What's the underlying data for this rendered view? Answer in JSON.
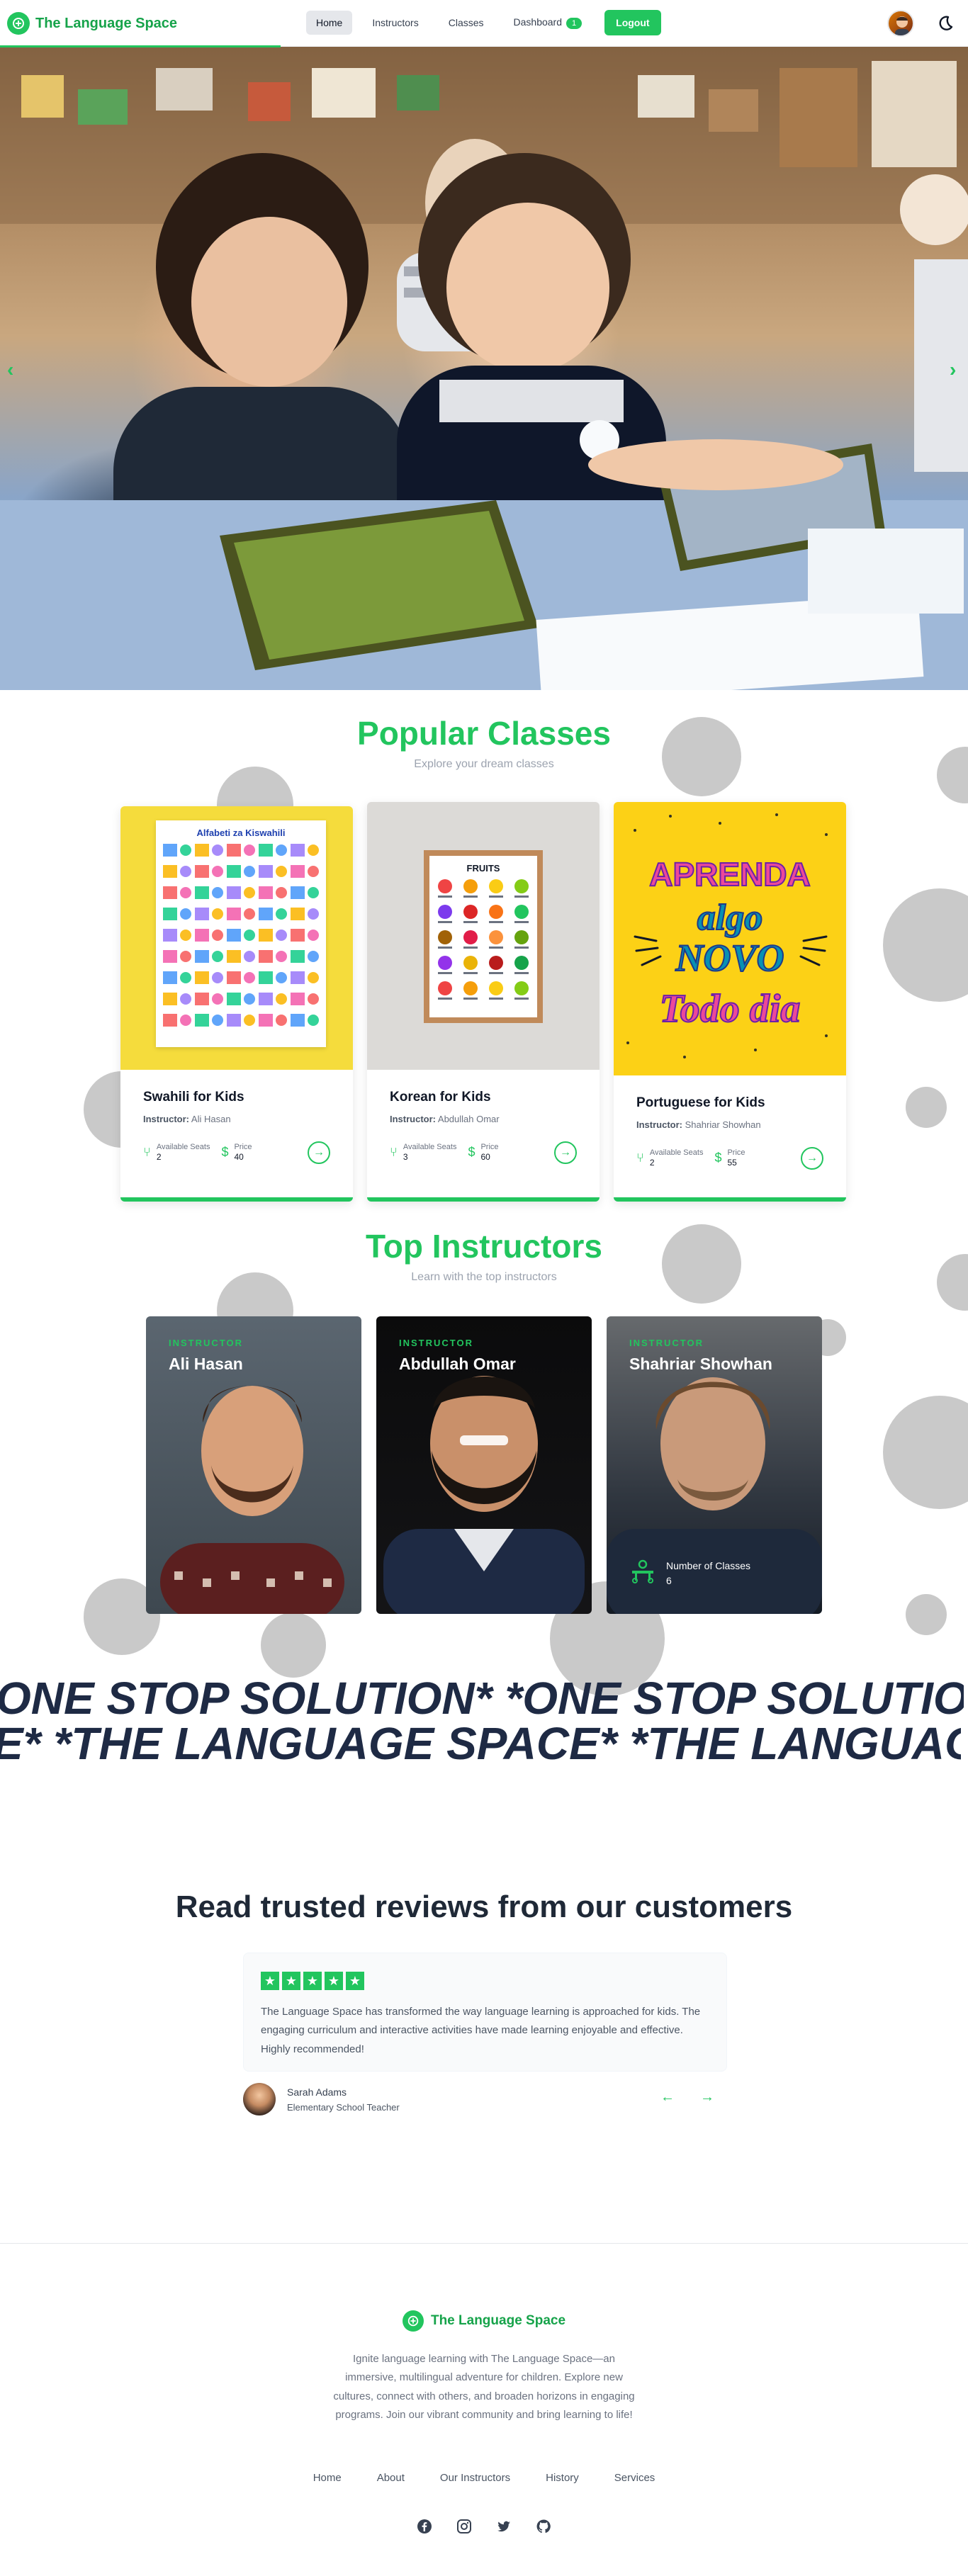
{
  "brand": {
    "name": "The Language Space"
  },
  "nav": {
    "links": [
      "Home",
      "Instructors",
      "Classes",
      "Dashboard"
    ],
    "dashboard_badge": "1",
    "logout": "Logout"
  },
  "colors": {
    "accent": "#22c55e",
    "dark_text": "#1e2a44",
    "dot_gray": "#c9c9c9"
  },
  "icons": [
    "theme-moon-icon",
    "arrow-right-icon",
    "seat-icon",
    "dollar-icon",
    "chair-group-icon",
    "facebook-icon",
    "instagram-icon",
    "twitter-icon",
    "github-icon"
  ],
  "popular": {
    "title": "Popular Classes",
    "subtitle": "Explore your dream classes",
    "instructor_prefix": "Instructor:",
    "seats_label": "Available Seats",
    "price_label": "Price",
    "classes": [
      {
        "title": "Swahili for Kids",
        "instructor": "Ali Hasan",
        "seats": "2",
        "price": "40",
        "poster_title": "Alfabeti za Kiswahili"
      },
      {
        "title": "Korean for Kids",
        "instructor": "Abdullah Omar",
        "seats": "3",
        "price": "60",
        "poster_title": "FRUITS"
      },
      {
        "title": "Portuguese for Kids",
        "instructor": "Shahriar Showhan",
        "seats": "2",
        "price": "55",
        "poster_lines": [
          "APRENDA",
          "algo",
          "NOVO",
          "Todo dia"
        ]
      }
    ]
  },
  "instructors": {
    "title": "Top Instructors",
    "subtitle": "Learn with the top instructors",
    "label": "INSTRUCTOR",
    "stats_label": "Number of Classes",
    "items": [
      {
        "name": "Ali Hasan"
      },
      {
        "name": "Abdullah Omar"
      },
      {
        "name": "Shahriar Showhan",
        "classes": "6"
      }
    ]
  },
  "marquee": {
    "line1": "ONE STOP SOLUTION*  *ONE STOP SOLUTION*  *ONE STOP SOLUTION*",
    "line2": "E*  *THE LANGUAGE SPACE*  *THE LANGUAGE SPACE*"
  },
  "reviews": {
    "title": "Read trusted reviews from our customers",
    "stars": 5,
    "text": "The Language Space has transformed the way language learning is approached for kids. The engaging curriculum and interactive activities have made learning enjoyable and effective. Highly recommended!",
    "reviewer_name": "Sarah Adams",
    "reviewer_role": "Elementary School Teacher",
    "prev": "←",
    "next": "→"
  },
  "footer": {
    "brand": "The Language Space",
    "description": "Ignite language learning with The Language Space—an immersive, multilingual adventure for children. Explore new cultures, connect with others, and broaden horizons in engaging programs. Join our vibrant community and bring learning to life!",
    "links": [
      "Home",
      "About",
      "Our Instructors",
      "History",
      "Services"
    ]
  }
}
